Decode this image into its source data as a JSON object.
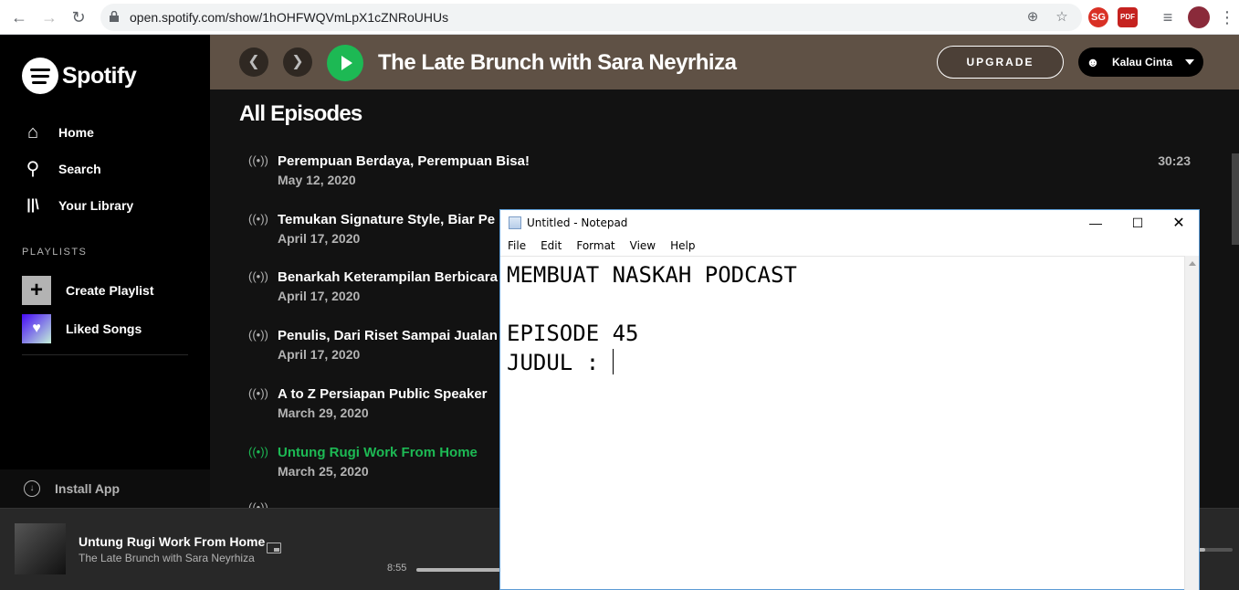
{
  "browser": {
    "url": "open.spotify.com/show/1hOHFWQVmLpX1cZNRoUHUs",
    "extensions": [
      "SG",
      "PDF"
    ]
  },
  "sidebar": {
    "logo_text": "Spotify",
    "nav": [
      {
        "label": "Home",
        "icon": "home-icon"
      },
      {
        "label": "Search",
        "icon": "search-icon"
      },
      {
        "label": "Your Library",
        "icon": "library-icon"
      }
    ],
    "playlists_title": "PLAYLISTS",
    "create_playlist": "Create Playlist",
    "liked_songs": "Liked Songs",
    "install_app": "Install App"
  },
  "header": {
    "show_title": "The Late Brunch with Sara Neyrhiza",
    "upgrade_label": "UPGRADE",
    "user_name": "Kalau Cinta"
  },
  "main": {
    "section_title": "All Episodes",
    "episodes": [
      {
        "title": "Perempuan Berdaya, Perempuan Bisa!",
        "date": "May 12, 2020",
        "duration": "30:23"
      },
      {
        "title": "Temukan Signature Style, Biar Pe",
        "date": "April 17, 2020",
        "duration": ""
      },
      {
        "title": "Benarkah Keterampilan Berbicara",
        "date": "April 17, 2020",
        "duration": ""
      },
      {
        "title": "Penulis, Dari Riset Sampai Jualan",
        "date": "April 17, 2020",
        "duration": ""
      },
      {
        "title": "A to Z Persiapan Public Speaker",
        "date": "March 29, 2020",
        "duration": ""
      },
      {
        "title": "Untung Rugi Work From Home",
        "date": "March 25, 2020",
        "duration": ""
      }
    ]
  },
  "player": {
    "now_playing_title": "Untung Rugi Work From Home",
    "now_playing_show": "The Late Brunch with Sara Neyrhiza",
    "elapsed": "8:55"
  },
  "notepad": {
    "window_title": "Untitled - Notepad",
    "menu": [
      "File",
      "Edit",
      "Format",
      "View",
      "Help"
    ],
    "lines": [
      "MEMBUAT NASKAH PODCAST",
      "",
      "EPISODE 45",
      "JUDUL : "
    ]
  },
  "colors": {
    "spotify_green": "#1db954",
    "header_bg": "#5f5145",
    "liked_songs_gradient": "#450af5"
  }
}
